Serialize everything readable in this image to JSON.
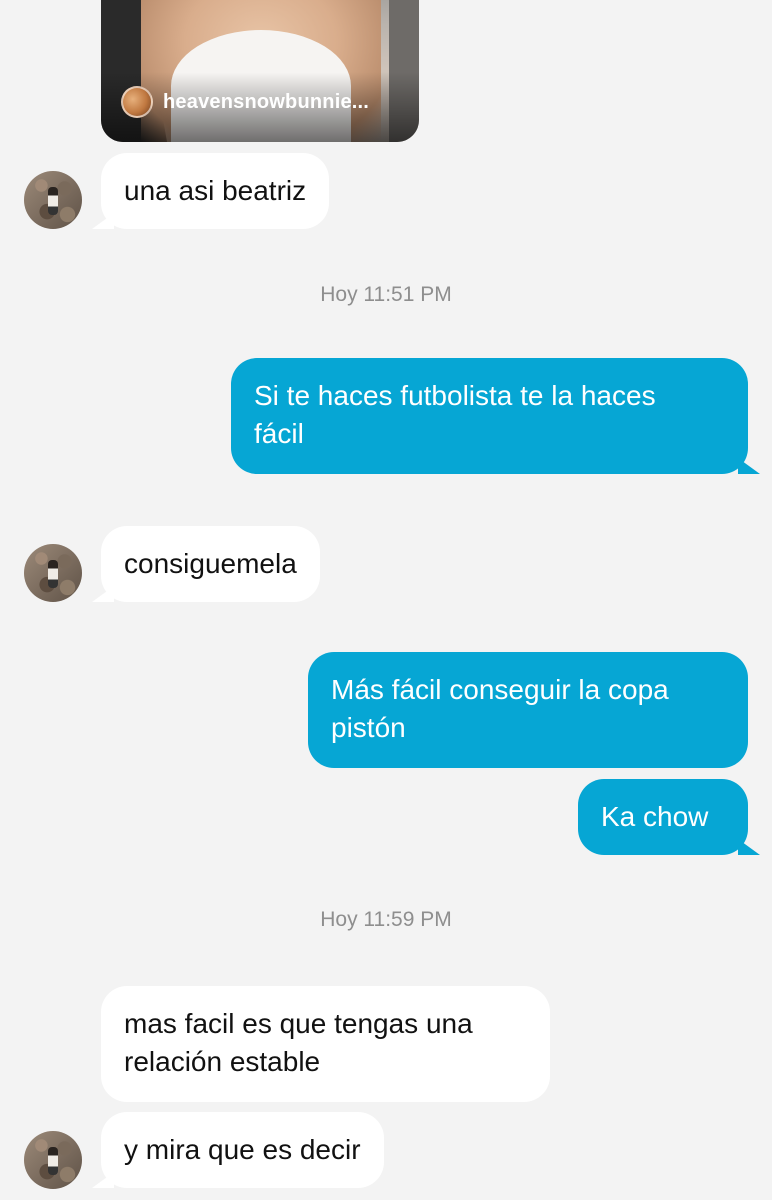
{
  "shared_post": {
    "username": "heavensnowbunnie..."
  },
  "messages": [
    {
      "id": "m1",
      "side": "in",
      "text": "una asi beatriz"
    },
    {
      "id": "m2",
      "side": "out",
      "lines": [
        "Si te haces futbolista te la haces",
        "fácil"
      ]
    },
    {
      "id": "m3",
      "side": "in",
      "text": "consiguemela"
    },
    {
      "id": "m4",
      "side": "out",
      "lines": [
        "Más fácil conseguir la copa",
        "pistón"
      ]
    },
    {
      "id": "m5",
      "side": "out",
      "text": "Ka chow"
    },
    {
      "id": "m6",
      "side": "in",
      "lines": [
        "mas facil es que tengas una",
        "relación estable"
      ]
    },
    {
      "id": "m7",
      "side": "in",
      "text": "y mira que es decir"
    }
  ],
  "timestamps": [
    "Hoy 11:51 PM",
    "Hoy 11:59 PM"
  ],
  "colors": {
    "background": "#f3f3f3",
    "incoming_bubble": "#ffffff",
    "outgoing_bubble": "#06a6d4",
    "timestamp_text": "#8e8e8e"
  },
  "icons": {
    "contact_avatar": "profile-photo",
    "shared_post_avatar": "profile-photo"
  }
}
